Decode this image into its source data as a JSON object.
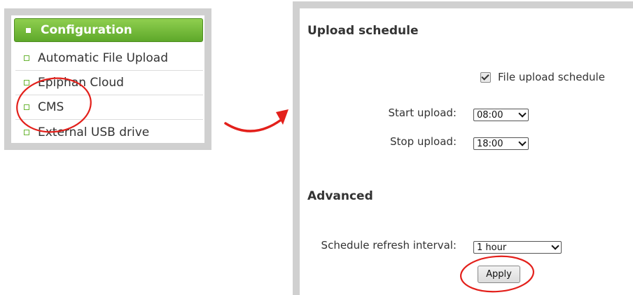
{
  "menu": {
    "header": "Configuration",
    "items": [
      {
        "label": "Automatic File Upload"
      },
      {
        "label": "Epiphan Cloud"
      },
      {
        "label": "CMS",
        "highlighted": true
      },
      {
        "label": "External USB drive"
      }
    ]
  },
  "upload_schedule": {
    "title": "Upload schedule",
    "checkbox_label": "File upload schedule",
    "checked": true,
    "start_label": "Start upload:",
    "start_value": "08:00",
    "stop_label": "Stop upload:",
    "stop_value": "18:00"
  },
  "advanced": {
    "title": "Advanced",
    "refresh_label": "Schedule refresh interval:",
    "refresh_value": "1 hour",
    "apply_label": "Apply"
  },
  "colors": {
    "menu_header": "#6cb533",
    "annotation": "#e3201b",
    "panel_border": "#d0d0d0"
  }
}
